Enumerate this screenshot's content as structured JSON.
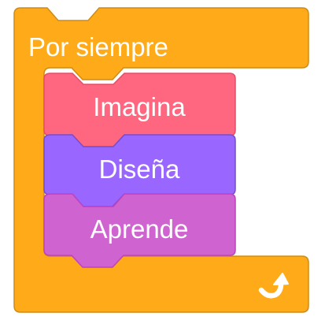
{
  "forever_block": {
    "label": "Por siempre",
    "color": "#FFAB19",
    "border_color": "#CF8B17",
    "loop_icon": "loop-arrow-icon"
  },
  "inner_blocks": [
    {
      "label": "Imagina",
      "color": "#FF6680",
      "border_color": "#E64D67"
    },
    {
      "label": "Diseña",
      "color": "#9966FF",
      "border_color": "#774DCB"
    },
    {
      "label": "Aprende",
      "color": "#CF63CF",
      "border_color": "#BD42BD"
    }
  ]
}
